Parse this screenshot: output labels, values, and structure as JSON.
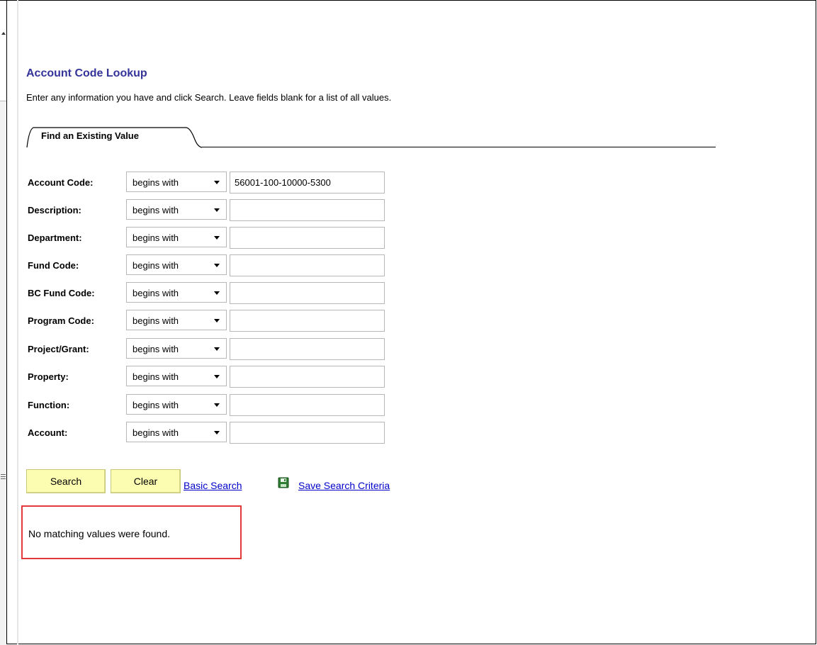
{
  "page": {
    "title": "Account Code Lookup",
    "instructions": "Enter any information you have and click Search. Leave fields blank for a list of all values."
  },
  "tabs": [
    {
      "label": "Find an Existing Value"
    }
  ],
  "criteria": [
    {
      "label": "Account Code:",
      "operator": "begins with",
      "value": "56001-100-10000-5300"
    },
    {
      "label": "Description:",
      "operator": "begins with",
      "value": ""
    },
    {
      "label": "Department:",
      "operator": "begins with",
      "value": ""
    },
    {
      "label": "Fund Code:",
      "operator": "begins with",
      "value": ""
    },
    {
      "label": "BC Fund Code:",
      "operator": "begins with",
      "value": ""
    },
    {
      "label": "Program Code:",
      "operator": "begins with",
      "value": ""
    },
    {
      "label": "Project/Grant:",
      "operator": "begins with",
      "value": ""
    },
    {
      "label": "Property:",
      "operator": "begins with",
      "value": ""
    },
    {
      "label": "Function:",
      "operator": "begins with",
      "value": ""
    },
    {
      "label": "Account:",
      "operator": "begins with",
      "value": ""
    }
  ],
  "actions": {
    "search_label": "Search",
    "clear_label": "Clear",
    "basic_search_label": "Basic Search",
    "save_criteria_label": "Save Search Criteria",
    "save_icon": "floppy-disk-icon"
  },
  "results": {
    "message": "No matching values were found."
  },
  "colors": {
    "title": "#333399",
    "link": "#0000cc",
    "button_bg": "#fdfdb1",
    "highlight_border": "#e33b3b"
  }
}
